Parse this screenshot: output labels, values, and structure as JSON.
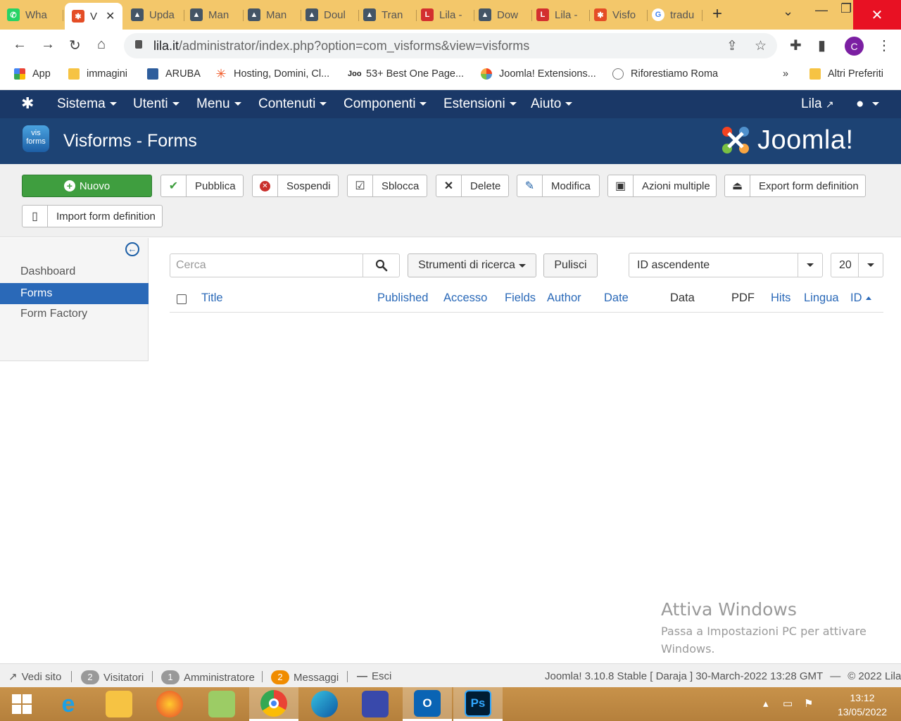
{
  "browser": {
    "tabs": [
      {
        "label": "Wha",
        "icon": "whatsapp-icon",
        "color": "#25d366"
      },
      {
        "label": "V",
        "icon": "joomla-icon",
        "color": "#e44d26",
        "active": true
      },
      {
        "label": "Upda",
        "icon": "mountain-image-icon",
        "color": "#445566"
      },
      {
        "label": "Man",
        "icon": "mountain-image-icon",
        "color": "#445566"
      },
      {
        "label": "Man",
        "icon": "mountain-image-icon",
        "color": "#445566"
      },
      {
        "label": "Doul",
        "icon": "mountain-image-icon",
        "color": "#445566"
      },
      {
        "label": "Tran",
        "icon": "mountain-image-icon",
        "color": "#445566"
      },
      {
        "label": "Lila -",
        "icon": "lila-icon",
        "color": "#d32f2f"
      },
      {
        "label": "Dow",
        "icon": "mountain-image-icon",
        "color": "#445566"
      },
      {
        "label": "Lila -",
        "icon": "lila-icon",
        "color": "#d32f2f"
      },
      {
        "label": "Visfo",
        "icon": "joomla-icon",
        "color": "#e44d26"
      },
      {
        "label": "tradu",
        "icon": "google-icon",
        "color": "#4285f4"
      }
    ],
    "url_host": "lila.it",
    "url_path": "/administrator/index.php?option=com_visforms&view=visforms",
    "profile_initial": "C",
    "bookmarks": [
      {
        "label": "App",
        "icon": "apps-grid-icon"
      },
      {
        "label": "immagini",
        "icon": "folder-icon"
      },
      {
        "label": "ARUBA",
        "icon": "aruba-icon"
      },
      {
        "label": "Hosting, Domini, Cl...",
        "icon": "star-burst-icon"
      },
      {
        "label": "53+ Best One Page...",
        "icon": "joo-icon"
      },
      {
        "label": "Joomla! Extensions...",
        "icon": "joomla-icon"
      },
      {
        "label": "Riforestiamo Roma",
        "icon": "tree-icon"
      }
    ],
    "more_bookmarks": "»",
    "other_bookmarks": "Altri Preferiti"
  },
  "joomla": {
    "menu": [
      "Sistema",
      "Utenti",
      "Menu",
      "Contenuti",
      "Componenti",
      "Estensioni",
      "Aiuto"
    ],
    "site_link": "Lila",
    "page_title": "Visforms - Forms",
    "brand": "Joomla!",
    "component_logo_text": [
      "vis",
      "forms"
    ],
    "toolbar": {
      "new": "Nuovo",
      "publish": "Pubblica",
      "unpublish": "Sospendi",
      "checkin": "Sblocca",
      "delete": "Delete",
      "edit": "Modifica",
      "batch": "Azioni multiple",
      "export": "Export form definition",
      "import": "Import form definition"
    },
    "sidebar": {
      "items": [
        {
          "label": "Dashboard",
          "active": false
        },
        {
          "label": "Forms",
          "active": true
        },
        {
          "label": "Form Factory",
          "active": false
        }
      ]
    },
    "filters": {
      "search_placeholder": "Cerca",
      "search_tools": "Strumenti di ricerca",
      "clear": "Pulisci",
      "ordering": "ID ascendente",
      "limit": "20"
    },
    "columns": [
      {
        "label": "Title",
        "sortable": true
      },
      {
        "label": "Published",
        "sortable": true
      },
      {
        "label": "Accesso",
        "sortable": true
      },
      {
        "label": "Fields",
        "sortable": true
      },
      {
        "label": "Author",
        "sortable": true
      },
      {
        "label": "Date",
        "sortable": true
      },
      {
        "label": "Data",
        "sortable": false
      },
      {
        "label": "PDF",
        "sortable": false
      },
      {
        "label": "Hits",
        "sortable": true
      },
      {
        "label": "Lingua",
        "sortable": true
      },
      {
        "label": "ID",
        "sortable": true,
        "sorted": "asc"
      }
    ],
    "status": {
      "view_site": "Vedi sito",
      "visitors_count": "2",
      "visitors_label": "Visitatori",
      "admins_count": "1",
      "admins_label": "Amministratore",
      "messages_count": "2",
      "messages_label": "Messaggi",
      "logout": "Esci",
      "version": "Joomla! 3.10.8 Stable [ Daraja ] 30-March-2022 13:28 GMT",
      "copyright": "© 2022 Lila"
    }
  },
  "windows": {
    "activation_title": "Attiva Windows",
    "activation_text": "Passa a Impostazioni PC per attivare Windows.",
    "time": "13:12",
    "date": "13/05/2022"
  },
  "colors": {
    "joomla_nav": "#1a3867",
    "joomla_header": "#1d4374",
    "accent_blue": "#2a69b8",
    "new_button": "#3f9e3f",
    "chrome_tabstrip": "#f3c76a"
  }
}
